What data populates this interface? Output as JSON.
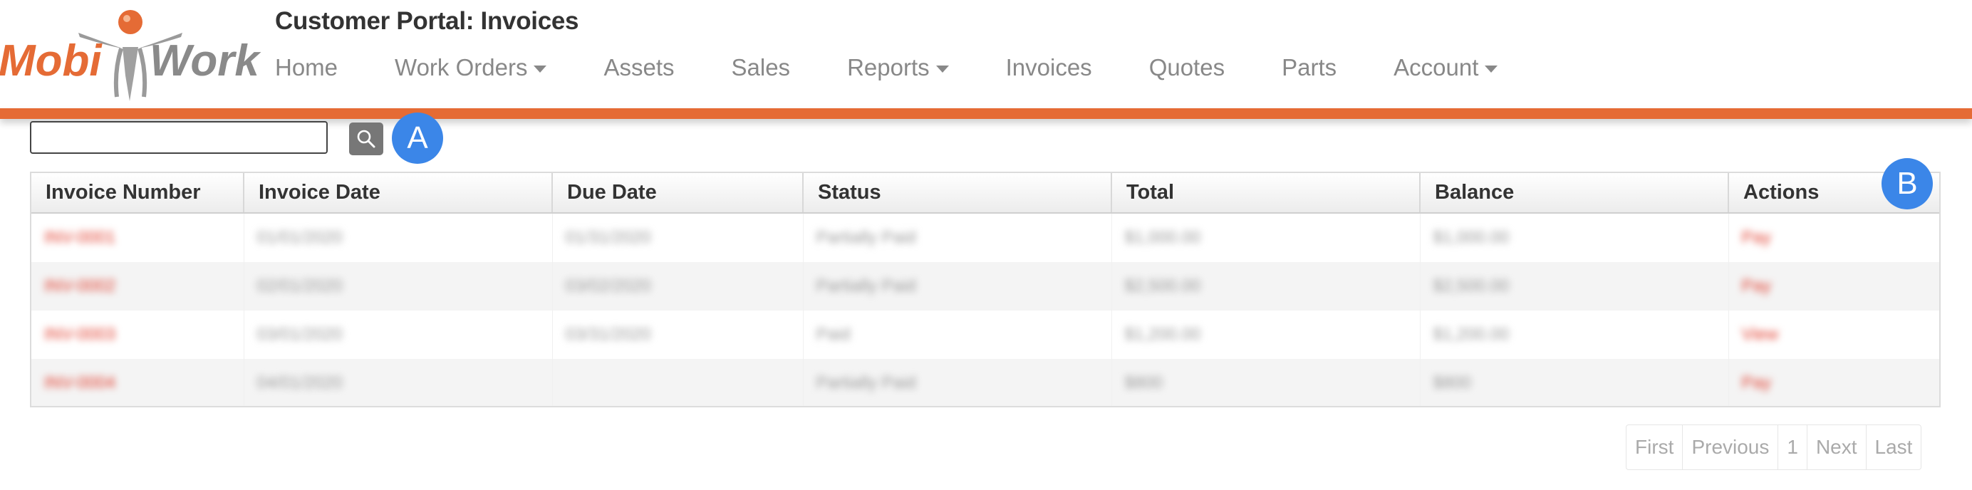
{
  "header": {
    "title": "Customer Portal: Invoices",
    "logo_text": "MobiWork",
    "brand_color": "#e56b35",
    "nav": [
      {
        "label": "Home",
        "dropdown": false
      },
      {
        "label": "Work Orders",
        "dropdown": true
      },
      {
        "label": "Assets",
        "dropdown": false
      },
      {
        "label": "Sales",
        "dropdown": false
      },
      {
        "label": "Reports",
        "dropdown": true
      },
      {
        "label": "Invoices",
        "dropdown": false
      },
      {
        "label": "Quotes",
        "dropdown": false
      },
      {
        "label": "Parts",
        "dropdown": false
      },
      {
        "label": "Account",
        "dropdown": true
      }
    ]
  },
  "search": {
    "value": "",
    "button_icon": "search-icon"
  },
  "markers": {
    "a": "A",
    "b": "B",
    "color": "#3b86e8"
  },
  "table": {
    "columns": [
      "Invoice Number",
      "Invoice Date",
      "Due Date",
      "Status",
      "Total",
      "Balance",
      "Actions"
    ],
    "rows": [
      [
        "INV-0001",
        "01/01/2020",
        "01/31/2020",
        "Partially Paid",
        "$1,000.00",
        "$1,000.00",
        "Pay"
      ],
      [
        "INV-0002",
        "02/01/2020",
        "03/02/2020",
        "Partially Paid",
        "$2,500.00",
        "$2,500.00",
        "Pay"
      ],
      [
        "INV-0003",
        "03/01/2020",
        "03/31/2020",
        "Paid",
        "$1,200.00",
        "$1,200.00",
        "View"
      ],
      [
        "INV-0004",
        "04/01/2020",
        "",
        "Partially Paid",
        "$800",
        "$800",
        "Pay"
      ]
    ]
  },
  "pagination": {
    "first": "First",
    "previous": "Previous",
    "current": "1",
    "next": "Next",
    "last": "Last"
  }
}
